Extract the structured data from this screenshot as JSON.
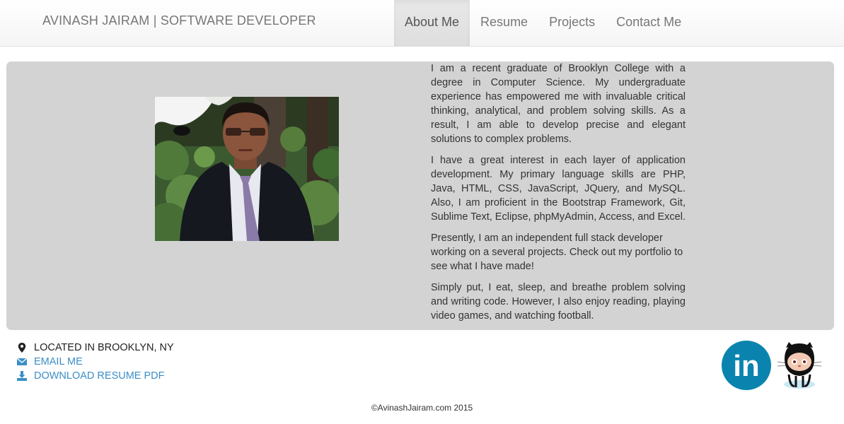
{
  "navbar": {
    "brand": "AVINASH JAIRAM | SOFTWARE DEVELOPER",
    "links": [
      {
        "label": "About Me",
        "active": true
      },
      {
        "label": "Resume",
        "active": false
      },
      {
        "label": "Projects",
        "active": false
      },
      {
        "label": "Contact Me",
        "active": false
      }
    ]
  },
  "about": {
    "paragraphs": [
      "I am a recent graduate of Brooklyn College with a degree in Computer Science. My undergraduate experience has empowered me with invaluable critical thinking, analytical, and problem solving skills. As a result, I am able to develop precise and elegant solutions to complex problems.",
      "I have a great interest in each layer of application development. My primary language skills are PHP, Java, HTML, CSS, JavaScript, JQuery, and MySQL. Also, I am proficient in the Bootstrap Framework, Git, Sublime Text, Eclipse, phpMyAdmin, Access, and Excel.",
      "Presently, I am an independent full stack developer working on a several projects. Check out my portfolio to see what I have made!",
      "Simply put, I eat, sleep, and breathe problem solving and writing code. However, I also enjoy reading, playing video games, and watching football."
    ]
  },
  "contact": {
    "location": "Located in Brooklyn, NY",
    "email": "Email Me",
    "resume": "Download Resume PDF",
    "icons": [
      "map-marker-icon",
      "envelope-icon",
      "download-icon"
    ]
  },
  "social": {
    "linkedin_text": "in",
    "icons": [
      "linkedin-icon",
      "github-octocat-icon"
    ]
  },
  "colors": {
    "panel": "#d3d3d3",
    "link": "#3b8ec6",
    "linkedin": "#0a84ae"
  },
  "footer": "©AvinashJairam.com 2015"
}
